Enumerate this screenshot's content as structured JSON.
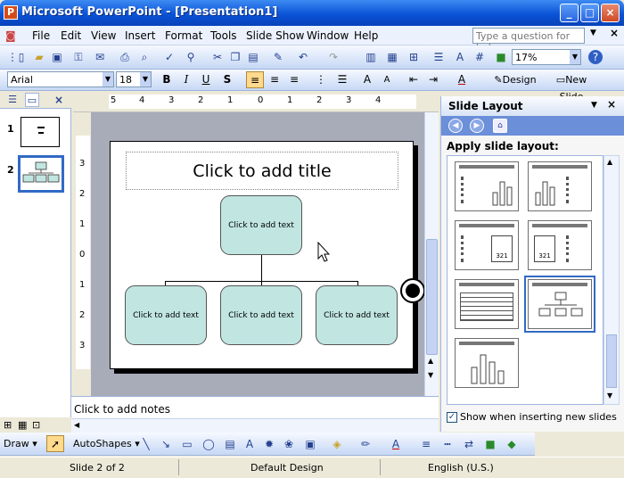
{
  "window": {
    "title": "Microsoft PowerPoint - [Presentation1]",
    "app_icon": "powerpoint-icon"
  },
  "menubar": {
    "items": [
      "File",
      "Edit",
      "View",
      "Insert",
      "Format",
      "Tools",
      "Slide Show",
      "Window",
      "Help"
    ],
    "help_placeholder": "Type a question for help"
  },
  "standard_toolbar": {
    "zoom": "17%"
  },
  "format_toolbar": {
    "font": "Arial",
    "size": "18",
    "design_label": "Design",
    "new_slide_label": "New Slide"
  },
  "left_pane": {
    "slide_numbers": [
      "1",
      "2"
    ],
    "selected": "2"
  },
  "rulers": {
    "h_ticks": [
      "5",
      "4",
      "3",
      "2",
      "1",
      "0",
      "1",
      "2",
      "3",
      "4"
    ],
    "v_ticks": [
      "3",
      "2",
      "1",
      "0",
      "1",
      "2",
      "3"
    ]
  },
  "slide": {
    "title_placeholder": "Click to add title",
    "nodes": [
      "Click to add text",
      "Click to add text",
      "Click to add text",
      "Click to add text"
    ]
  },
  "notes": {
    "placeholder": "Click to add notes"
  },
  "task_pane": {
    "title": "Slide Layout",
    "section_label": "Apply slide layout:",
    "checkbox_label": "Show when inserting new slides",
    "checkbox_checked": true
  },
  "draw_toolbar": {
    "draw_label": "Draw",
    "autoshapes_label": "AutoShapes"
  },
  "statusbar": {
    "slide_pos": "Slide 2 of 2",
    "design": "Default Design",
    "language": "English (U.S.)"
  }
}
